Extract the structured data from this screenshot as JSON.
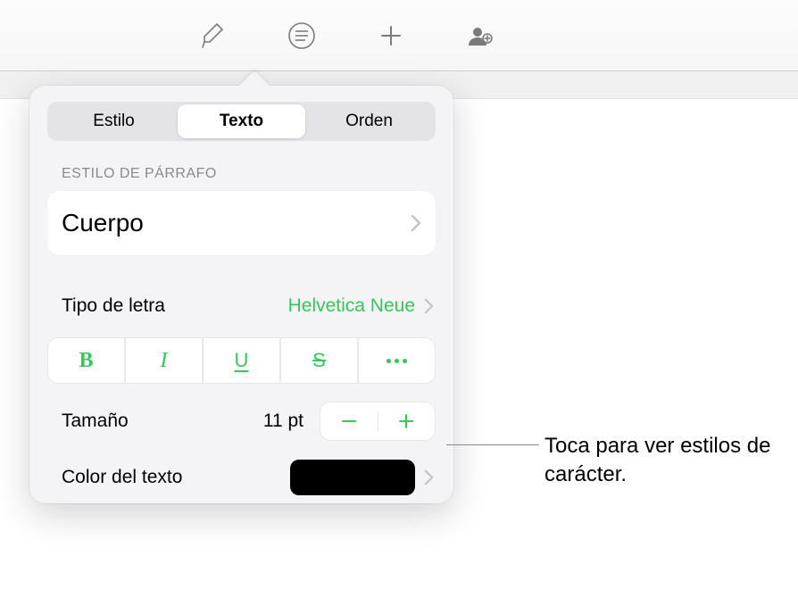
{
  "toolbar": {
    "icons": [
      "format-brush",
      "list-format",
      "insert",
      "collaborate"
    ]
  },
  "tabs": {
    "style": "Estilo",
    "text": "Texto",
    "arrange": "Orden",
    "active": "text"
  },
  "paragraph_style": {
    "section_label": "Estilo de párrafo",
    "value": "Cuerpo"
  },
  "font": {
    "label": "Tipo de letra",
    "value": "Helvetica Neue",
    "style_glyphs": {
      "bold": "B",
      "italic": "I",
      "underline": "U",
      "strike": "S"
    }
  },
  "size": {
    "label": "Tamaño",
    "value": "11 pt"
  },
  "text_color": {
    "label": "Color del texto",
    "swatch": "#000000"
  },
  "callout": "Toca para ver estilos de carácter."
}
